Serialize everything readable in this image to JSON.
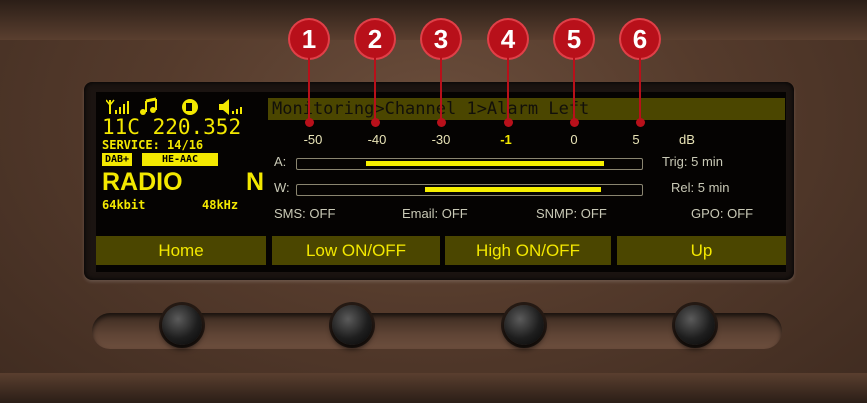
{
  "callouts": [
    "1",
    "2",
    "3",
    "4",
    "5",
    "6"
  ],
  "status": {
    "channel": "11C",
    "frequency": "220.352",
    "service": "SERVICE: 14/16",
    "dab_tag": "DAB+",
    "codec_tag": "HE-AAC",
    "station": "RADIO",
    "station_suffix": "N",
    "bitrate": "64kbit",
    "sample_rate": "48kHz"
  },
  "breadcrumb": "Monitoring>Channel 1>Alarm Left",
  "scale": {
    "values": [
      "-50",
      "-40",
      "-30",
      "-1",
      "0",
      "5"
    ],
    "unit": "dB"
  },
  "meters": [
    {
      "label": "A:",
      "fill_start": 0.2,
      "fill_end": 0.89
    },
    {
      "label": "W:",
      "fill_start": 0.37,
      "fill_end": 0.88
    }
  ],
  "timers": {
    "trig": "Trig: 5 min",
    "rel": "Rel: 5 min"
  },
  "notifications": {
    "sms": "SMS: OFF",
    "email": "Email: OFF",
    "snmp": "SNMP: OFF",
    "gpo": "GPO: OFF"
  },
  "softkeys": {
    "home": "Home",
    "low": "Low ON/OFF",
    "high": "High ON/OFF",
    "up": "Up"
  },
  "colors": {
    "display_yellow": "#f3e800",
    "callout_red": "#b8101a",
    "softkey_bg": "#4b4600"
  }
}
